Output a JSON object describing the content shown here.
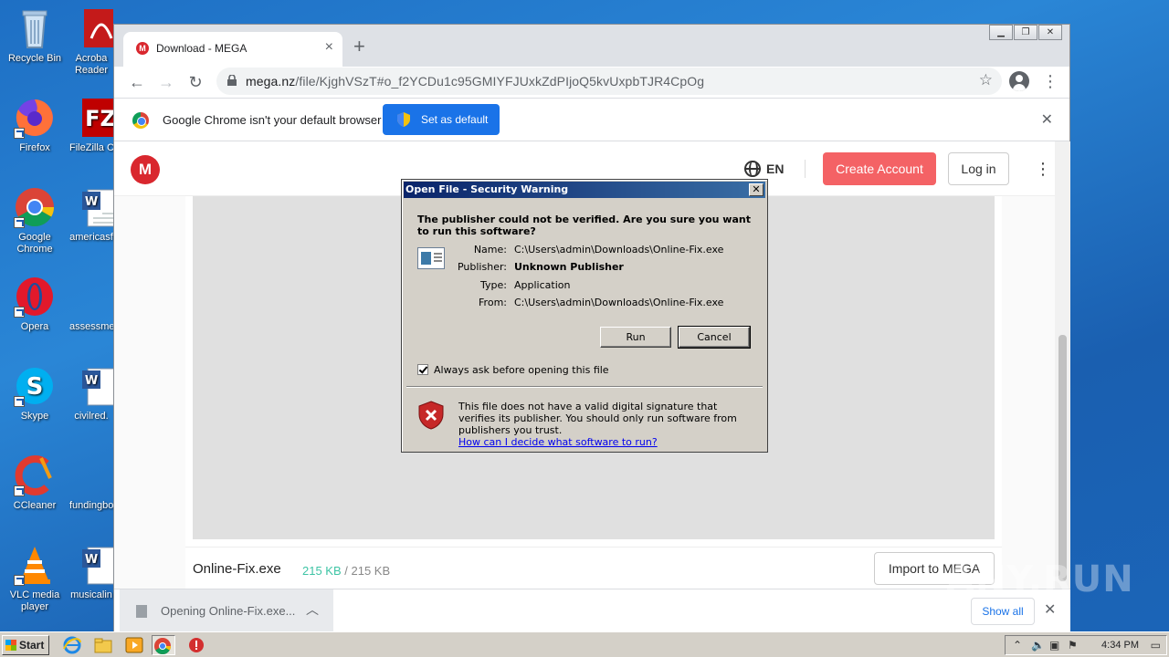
{
  "desktop": {
    "icons": [
      {
        "label": "Recycle Bin"
      },
      {
        "label": "Firefox"
      },
      {
        "label": "Google Chrome"
      },
      {
        "label": "Opera"
      },
      {
        "label": "Skype"
      },
      {
        "label": "CCleaner"
      },
      {
        "label": "VLC media player"
      }
    ],
    "icons_col2": [
      {
        "label": "Acroba Reader"
      },
      {
        "label": "FileZilla C"
      },
      {
        "label": "americasf"
      },
      {
        "label": "assessme"
      },
      {
        "label": "civilred."
      },
      {
        "label": "fundingbo"
      },
      {
        "label": "musicalin"
      }
    ]
  },
  "browser": {
    "tab_title": "Download - MEGA",
    "tab_favicon": "M",
    "url_host": "mega.nz",
    "url_rest": "/file/KjghVSzT#o_f2YCDu1c95GMIYFJUxkZdPIjoQ5kvUxpbTJR4CpOg",
    "infobar_message": "Google Chrome isn't your default browser",
    "infobar_button": "Set as default"
  },
  "mega": {
    "logo_letter": "M",
    "language": "EN",
    "create_account": "Create Account",
    "login": "Log in",
    "file_name": "Online-Fix.exe",
    "downloaded": "215 KB",
    "size_sep": " / ",
    "total": "215 KB",
    "import_button": "Import to MEGA"
  },
  "downloads": {
    "item_text": "Opening Online-Fix.exe...",
    "show_all": "Show all"
  },
  "dialog": {
    "title": "Open File - Security Warning",
    "question": "The publisher could not be verified.  Are you sure you want to run this software?",
    "name_label": "Name:",
    "name_value": "C:\\Users\\admin\\Downloads\\Online-Fix.exe",
    "publisher_label": "Publisher:",
    "publisher_value": "Unknown Publisher",
    "type_label": "Type:",
    "type_value": "Application",
    "from_label": "From:",
    "from_value": "C:\\Users\\admin\\Downloads\\Online-Fix.exe",
    "run_button": "Run",
    "cancel_button": "Cancel",
    "checkbox_label": "Always ask before opening this file",
    "checkbox_checked": true,
    "warning_text": "This file does not have a valid digital signature that verifies its publisher.  You should only run software from publishers you trust.",
    "help_link": "How can I decide what software to run?"
  },
  "taskbar": {
    "start_label": "Start",
    "clock": "4:34 PM"
  },
  "watermark": "ANY.RUN",
  "colors": {
    "mega_red": "#d9272e",
    "create_btn": "#f46265",
    "chrome_blue": "#1a73e8",
    "xp_title": "#0a246a"
  }
}
